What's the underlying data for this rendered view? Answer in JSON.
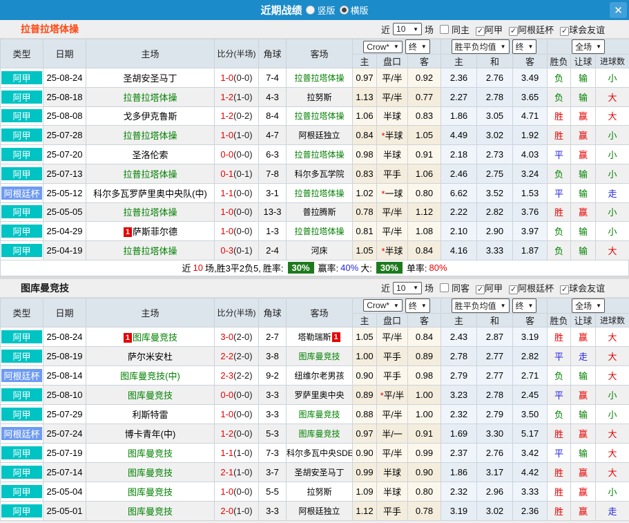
{
  "titlebar": {
    "title": "近期战绩",
    "radio_vertical": "竖版",
    "radio_horizontal": "横版",
    "vertical_checked": false,
    "horizontal_checked": true,
    "close_icon": "✕"
  },
  "columns": {
    "type": "类型",
    "date": "日期",
    "home": "主场",
    "score": "比分(半场)",
    "corner": "角球",
    "away": "客场",
    "sub": [
      "主",
      "盘口",
      "客",
      "主",
      "和",
      "客",
      "胜负",
      "让球",
      "进球数"
    ],
    "selects": [
      "Crow*",
      "终",
      "胜平负均值",
      "终",
      "全场"
    ]
  },
  "type_colors": {
    "阿甲": "#00c3c3",
    "阿根廷杯": "#6e9bf2"
  },
  "result_colors": {
    "胜": "#e60000",
    "赢": "#e60000",
    "大": "#e60000",
    "平": "#2323e0",
    "走": "#2323e0",
    "负": "#008000",
    "输": "#008000",
    "小": "#008000"
  },
  "sections": [
    {
      "team": "拉普拉塔体操",
      "team_color": "#ff4a14",
      "filter": {
        "near_label": "近",
        "count": "10",
        "games_label": "场",
        "same_label": "同主",
        "same_checked": false,
        "leagues": [
          {
            "label": "阿甲",
            "checked": true
          },
          {
            "label": "阿根廷杯",
            "checked": true
          },
          {
            "label": "球会友谊",
            "checked": true
          }
        ]
      },
      "rows": [
        {
          "type": "阿甲",
          "date": "25-08-24",
          "home": "圣胡安圣马丁",
          "homeFocus": false,
          "homeBadge": "",
          "score": "1-0",
          "half": "(0-0)",
          "corner": "7-4",
          "away": "拉普拉塔体操",
          "awayFocus": true,
          "awayBadge": "",
          "crowHome": "0.97",
          "handicap": "平/半",
          "crowAway": "0.92",
          "avgHome": "2.36",
          "avgDraw": "2.76",
          "avgAway": "3.49",
          "result": "负",
          "letBall": "输",
          "goals": "小"
        },
        {
          "type": "阿甲",
          "date": "25-08-18",
          "home": "拉普拉塔体操",
          "homeFocus": true,
          "homeBadge": "",
          "score": "1-2",
          "half": "(1-0)",
          "corner": "4-3",
          "away": "拉努斯",
          "awayFocus": false,
          "awayBadge": "",
          "crowHome": "1.13",
          "handicap": "平/半",
          "crowAway": "0.77",
          "avgHome": "2.27",
          "avgDraw": "2.78",
          "avgAway": "3.65",
          "result": "负",
          "letBall": "输",
          "goals": "大"
        },
        {
          "type": "阿甲",
          "date": "25-08-08",
          "home": "戈多伊克鲁斯",
          "homeFocus": false,
          "homeBadge": "",
          "score": "1-2",
          "half": "(0-2)",
          "corner": "8-4",
          "away": "拉普拉塔体操",
          "awayFocus": true,
          "awayBadge": "",
          "crowHome": "1.06",
          "handicap": "半球",
          "crowAway": "0.83",
          "avgHome": "1.86",
          "avgDraw": "3.05",
          "avgAway": "4.71",
          "result": "胜",
          "letBall": "赢",
          "goals": "大"
        },
        {
          "type": "阿甲",
          "date": "25-07-28",
          "home": "拉普拉塔体操",
          "homeFocus": true,
          "homeBadge": "",
          "score": "1-0",
          "half": "(1-0)",
          "corner": "4-7",
          "away": "阿根廷独立",
          "awayFocus": false,
          "awayBadge": "",
          "crowHome": "0.84",
          "handicap": "*半球",
          "crowAway": "1.05",
          "avgHome": "4.49",
          "avgDraw": "3.02",
          "avgAway": "1.92",
          "result": "胜",
          "letBall": "赢",
          "goals": "小"
        },
        {
          "type": "阿甲",
          "date": "25-07-20",
          "home": "圣洛伦索",
          "homeFocus": false,
          "homeBadge": "",
          "score": "0-0",
          "half": "(0-0)",
          "corner": "6-3",
          "away": "拉普拉塔体操",
          "awayFocus": true,
          "awayBadge": "",
          "crowHome": "0.98",
          "handicap": "半球",
          "crowAway": "0.91",
          "avgHome": "2.18",
          "avgDraw": "2.73",
          "avgAway": "4.03",
          "result": "平",
          "letBall": "赢",
          "goals": "小"
        },
        {
          "type": "阿甲",
          "date": "25-07-13",
          "home": "拉普拉塔体操",
          "homeFocus": true,
          "homeBadge": "",
          "score": "0-1",
          "half": "(0-1)",
          "corner": "7-8",
          "away": "科尔多瓦学院",
          "awayFocus": false,
          "awayBadge": "",
          "crowHome": "0.83",
          "handicap": "平手",
          "crowAway": "1.06",
          "avgHome": "2.46",
          "avgDraw": "2.75",
          "avgAway": "3.24",
          "result": "负",
          "letBall": "输",
          "goals": "小"
        },
        {
          "type": "阿根廷杯",
          "date": "25-05-12",
          "home": "科尔多瓦罗萨里奥中央队(中)",
          "homeFocus": false,
          "homeBadge": "",
          "score": "1-1",
          "half": "(0-0)",
          "corner": "3-1",
          "away": "拉普拉塔体操",
          "awayFocus": true,
          "awayBadge": "",
          "crowHome": "1.02",
          "handicap": "*一球",
          "crowAway": "0.80",
          "avgHome": "6.62",
          "avgDraw": "3.52",
          "avgAway": "1.53",
          "result": "平",
          "letBall": "输",
          "goals": "走"
        },
        {
          "type": "阿甲",
          "date": "25-05-05",
          "home": "拉普拉塔体操",
          "homeFocus": true,
          "homeBadge": "",
          "score": "1-0",
          "half": "(0-0)",
          "corner": "13-3",
          "away": "普拉腾斯",
          "awayFocus": false,
          "awayBadge": "",
          "crowHome": "0.78",
          "handicap": "平/半",
          "crowAway": "1.12",
          "avgHome": "2.22",
          "avgDraw": "2.82",
          "avgAway": "3.76",
          "result": "胜",
          "letBall": "赢",
          "goals": "小"
        },
        {
          "type": "阿甲",
          "date": "25-04-29",
          "home": "萨斯菲尔德",
          "homeFocus": false,
          "homeBadge": "1",
          "score": "1-0",
          "half": "(0-0)",
          "corner": "1-3",
          "away": "拉普拉塔体操",
          "awayFocus": true,
          "awayBadge": "",
          "crowHome": "0.81",
          "handicap": "平/半",
          "crowAway": "1.08",
          "avgHome": "2.10",
          "avgDraw": "2.90",
          "avgAway": "3.97",
          "result": "负",
          "letBall": "输",
          "goals": "小"
        },
        {
          "type": "阿甲",
          "date": "25-04-19",
          "home": "拉普拉塔体操",
          "homeFocus": true,
          "homeBadge": "",
          "score": "0-3",
          "half": "(0-1)",
          "corner": "2-4",
          "away": "河床",
          "awayFocus": false,
          "awayBadge": "",
          "crowHome": "1.05",
          "handicap": "*半球",
          "crowAway": "0.84",
          "avgHome": "4.16",
          "avgDraw": "3.33",
          "avgAway": "1.87",
          "result": "负",
          "letBall": "输",
          "goals": "大"
        }
      ],
      "summary": {
        "near_label": "近",
        "count": "10",
        "record": "场,胜3平2负5,",
        "win_rate_label": "胜率:",
        "win_rate": "30%",
        "profit_label": "赢率:",
        "profit_rate": "40%",
        "big_label": "大:",
        "big_rate": "30%",
        "single_label": "单率:",
        "single_rate": "80%"
      }
    },
    {
      "team": "图库曼竞技",
      "team_color": "#1a1a1a",
      "filter": {
        "near_label": "近",
        "count": "10",
        "games_label": "场",
        "same_label": "同客",
        "same_checked": false,
        "leagues": [
          {
            "label": "阿甲",
            "checked": true
          },
          {
            "label": "阿根廷杯",
            "checked": true
          },
          {
            "label": "球会友谊",
            "checked": true
          }
        ]
      },
      "rows": [
        {
          "type": "阿甲",
          "date": "25-08-24",
          "home": "图库曼竞技",
          "homeFocus": true,
          "homeBadge": "1",
          "score": "3-0",
          "half": "(2-0)",
          "corner": "2-7",
          "away": "塔勒瑞斯",
          "awayFocus": false,
          "awayBadge": "1",
          "crowHome": "1.05",
          "handicap": "平/半",
          "crowAway": "0.84",
          "avgHome": "2.43",
          "avgDraw": "2.87",
          "avgAway": "3.19",
          "result": "胜",
          "letBall": "赢",
          "goals": "大"
        },
        {
          "type": "阿甲",
          "date": "25-08-19",
          "home": "萨尔米安杜",
          "homeFocus": false,
          "homeBadge": "",
          "score": "2-2",
          "half": "(2-0)",
          "corner": "3-8",
          "away": "图库曼竞技",
          "awayFocus": true,
          "awayBadge": "",
          "crowHome": "1.00",
          "handicap": "平手",
          "crowAway": "0.89",
          "avgHome": "2.78",
          "avgDraw": "2.77",
          "avgAway": "2.82",
          "result": "平",
          "letBall": "走",
          "goals": "大"
        },
        {
          "type": "阿根廷杯",
          "date": "25-08-14",
          "home": "图库曼竞技(中)",
          "homeFocus": true,
          "homeBadge": "",
          "score": "2-3",
          "half": "(2-2)",
          "corner": "9-2",
          "away": "纽维尔老男孩",
          "awayFocus": false,
          "awayBadge": "",
          "crowHome": "0.90",
          "handicap": "平手",
          "crowAway": "0.98",
          "avgHome": "2.79",
          "avgDraw": "2.77",
          "avgAway": "2.71",
          "result": "负",
          "letBall": "输",
          "goals": "大"
        },
        {
          "type": "阿甲",
          "date": "25-08-10",
          "home": "图库曼竞技",
          "homeFocus": true,
          "homeBadge": "",
          "score": "0-0",
          "half": "(0-0)",
          "corner": "3-3",
          "away": "罗萨里奥中央",
          "awayFocus": false,
          "awayBadge": "",
          "crowHome": "0.89",
          "handicap": "*平/半",
          "crowAway": "1.00",
          "avgHome": "3.23",
          "avgDraw": "2.78",
          "avgAway": "2.45",
          "result": "平",
          "letBall": "赢",
          "goals": "小"
        },
        {
          "type": "阿甲",
          "date": "25-07-29",
          "home": "利斯特雷",
          "homeFocus": false,
          "homeBadge": "",
          "score": "1-0",
          "half": "(0-0)",
          "corner": "3-3",
          "away": "图库曼竞技",
          "awayFocus": true,
          "awayBadge": "",
          "crowHome": "0.88",
          "handicap": "平/半",
          "crowAway": "1.00",
          "avgHome": "2.32",
          "avgDraw": "2.79",
          "avgAway": "3.50",
          "result": "负",
          "letBall": "输",
          "goals": "小"
        },
        {
          "type": "阿根廷杯",
          "date": "25-07-24",
          "home": "博卡青年(中)",
          "homeFocus": false,
          "homeBadge": "",
          "score": "1-2",
          "half": "(0-0)",
          "corner": "5-3",
          "away": "图库曼竞技",
          "awayFocus": true,
          "awayBadge": "",
          "crowHome": "0.97",
          "handicap": "半/一",
          "crowAway": "0.91",
          "avgHome": "1.69",
          "avgDraw": "3.30",
          "avgAway": "5.17",
          "result": "胜",
          "letBall": "赢",
          "goals": "大"
        },
        {
          "type": "阿甲",
          "date": "25-07-19",
          "home": "图库曼竞技",
          "homeFocus": true,
          "homeBadge": "",
          "score": "1-1",
          "half": "(1-0)",
          "corner": "7-3",
          "away": "科尔多瓦中央SDE",
          "awayFocus": false,
          "awayBadge": "",
          "crowHome": "0.90",
          "handicap": "平/半",
          "crowAway": "0.99",
          "avgHome": "2.37",
          "avgDraw": "2.76",
          "avgAway": "3.42",
          "result": "平",
          "letBall": "输",
          "goals": "大"
        },
        {
          "type": "阿甲",
          "date": "25-07-14",
          "home": "图库曼竞技",
          "homeFocus": true,
          "homeBadge": "",
          "score": "2-1",
          "half": "(1-0)",
          "corner": "3-7",
          "away": "圣胡安圣马丁",
          "awayFocus": false,
          "awayBadge": "",
          "crowHome": "0.99",
          "handicap": "半球",
          "crowAway": "0.90",
          "avgHome": "1.86",
          "avgDraw": "3.17",
          "avgAway": "4.42",
          "result": "胜",
          "letBall": "赢",
          "goals": "大"
        },
        {
          "type": "阿甲",
          "date": "25-05-04",
          "home": "图库曼竞技",
          "homeFocus": true,
          "homeBadge": "",
          "score": "1-0",
          "half": "(0-0)",
          "corner": "5-5",
          "away": "拉努斯",
          "awayFocus": false,
          "awayBadge": "",
          "crowHome": "1.09",
          "handicap": "半球",
          "crowAway": "0.80",
          "avgHome": "2.32",
          "avgDraw": "2.96",
          "avgAway": "3.33",
          "result": "胜",
          "letBall": "赢",
          "goals": "小"
        },
        {
          "type": "阿甲",
          "date": "25-05-01",
          "home": "图库曼竞技",
          "homeFocus": true,
          "homeBadge": "",
          "score": "2-0",
          "half": "(1-0)",
          "corner": "3-3",
          "away": "阿根廷独立",
          "awayFocus": false,
          "awayBadge": "",
          "crowHome": "1.12",
          "handicap": "平手",
          "crowAway": "0.78",
          "avgHome": "3.19",
          "avgDraw": "3.02",
          "avgAway": "2.36",
          "result": "胜",
          "letBall": "赢",
          "goals": "走"
        }
      ]
    }
  ]
}
